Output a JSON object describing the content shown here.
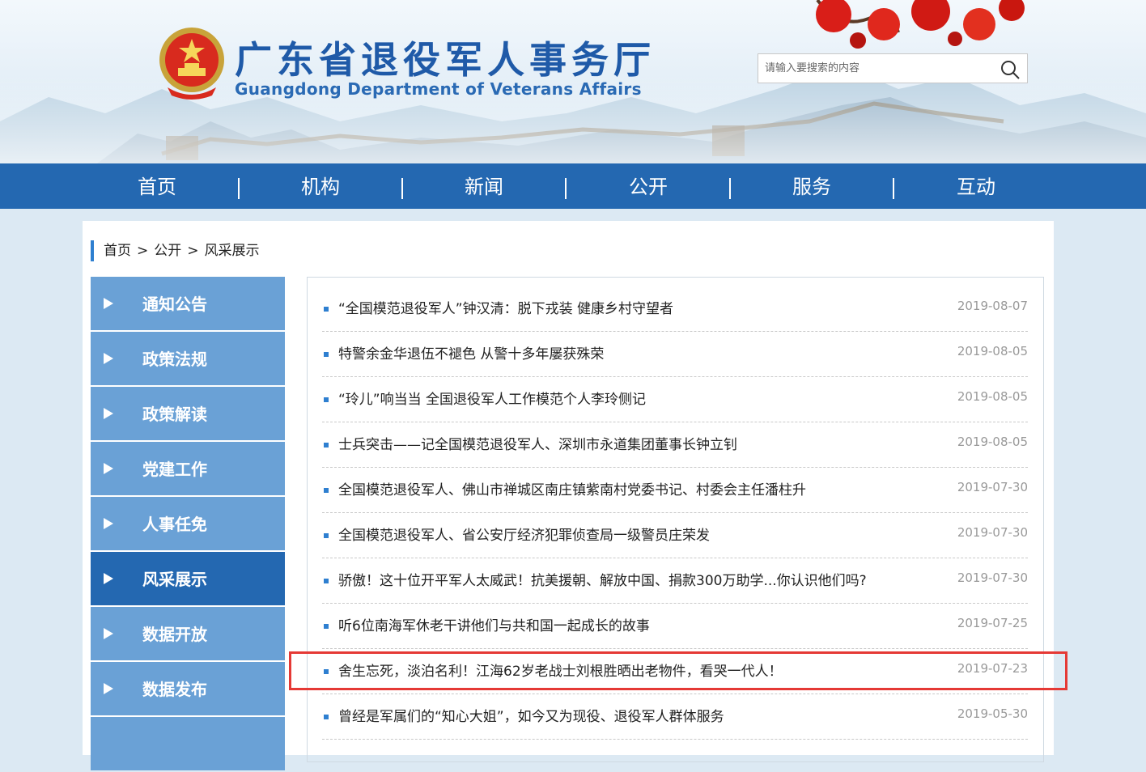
{
  "header": {
    "title": "广东省退役军人事务厅",
    "subtitle": "Guangdong Department of Veterans Affairs",
    "search_placeholder": "请输入要搜索的内容",
    "icons": [
      "national-emblem",
      "search-icon"
    ],
    "colors": {
      "brand_blue": "#2468b1",
      "title_blue": "#1f5aa8",
      "flower_red": "#d91e18"
    }
  },
  "nav": {
    "items": [
      "首页",
      "机构",
      "新闻",
      "公开",
      "服务",
      "互动"
    ],
    "separator": "|"
  },
  "breadcrumb": {
    "items": [
      "首页",
      "公开",
      "风采展示"
    ],
    "separator": ">"
  },
  "sidebar": {
    "items": [
      {
        "label": "通知公告",
        "active": false
      },
      {
        "label": "政策法规",
        "active": false
      },
      {
        "label": "政策解读",
        "active": false
      },
      {
        "label": "党建工作",
        "active": false
      },
      {
        "label": "人事任免",
        "active": false
      },
      {
        "label": "风采展示",
        "active": true
      },
      {
        "label": "数据开放",
        "active": false
      },
      {
        "label": "数据发布",
        "active": false
      }
    ]
  },
  "articles": [
    {
      "title": "“全国模范退役军人”钟汉清：脱下戎装 健康乡村守望者",
      "date": "2019-08-07"
    },
    {
      "title": "特警余金华退伍不褪色 从警十多年屡获殊荣",
      "date": "2019-08-05"
    },
    {
      "title": "“玲儿”响当当 全国退役军人工作模范个人李玲侧记",
      "date": "2019-08-05"
    },
    {
      "title": "士兵突击——记全国模范退役军人、深圳市永道集团董事长钟立钊",
      "date": "2019-08-05"
    },
    {
      "title": "全国模范退役军人、佛山市禅城区南庄镇紫南村党委书记、村委会主任潘柱升",
      "date": "2019-07-30"
    },
    {
      "title": "全国模范退役军人、省公安厅经济犯罪侦查局一级警员庄荣发",
      "date": "2019-07-30"
    },
    {
      "title": "骄傲！这十位开平军人太威武！抗美援朝、解放中国、捐款300万助学...你认识他们吗?",
      "date": "2019-07-30"
    },
    {
      "title": "听6位南海军休老干讲他们与共和国一起成长的故事",
      "date": "2019-07-25"
    },
    {
      "title": "舍生忘死，淡泊名利！江海62岁老战士刘根胜晒出老物件，看哭一代人！",
      "date": "2019-07-23",
      "highlighted": true
    },
    {
      "title": "曾经是军属们的“知心大姐”，如今又为现役、退役军人群体服务",
      "date": "2019-05-30"
    }
  ]
}
